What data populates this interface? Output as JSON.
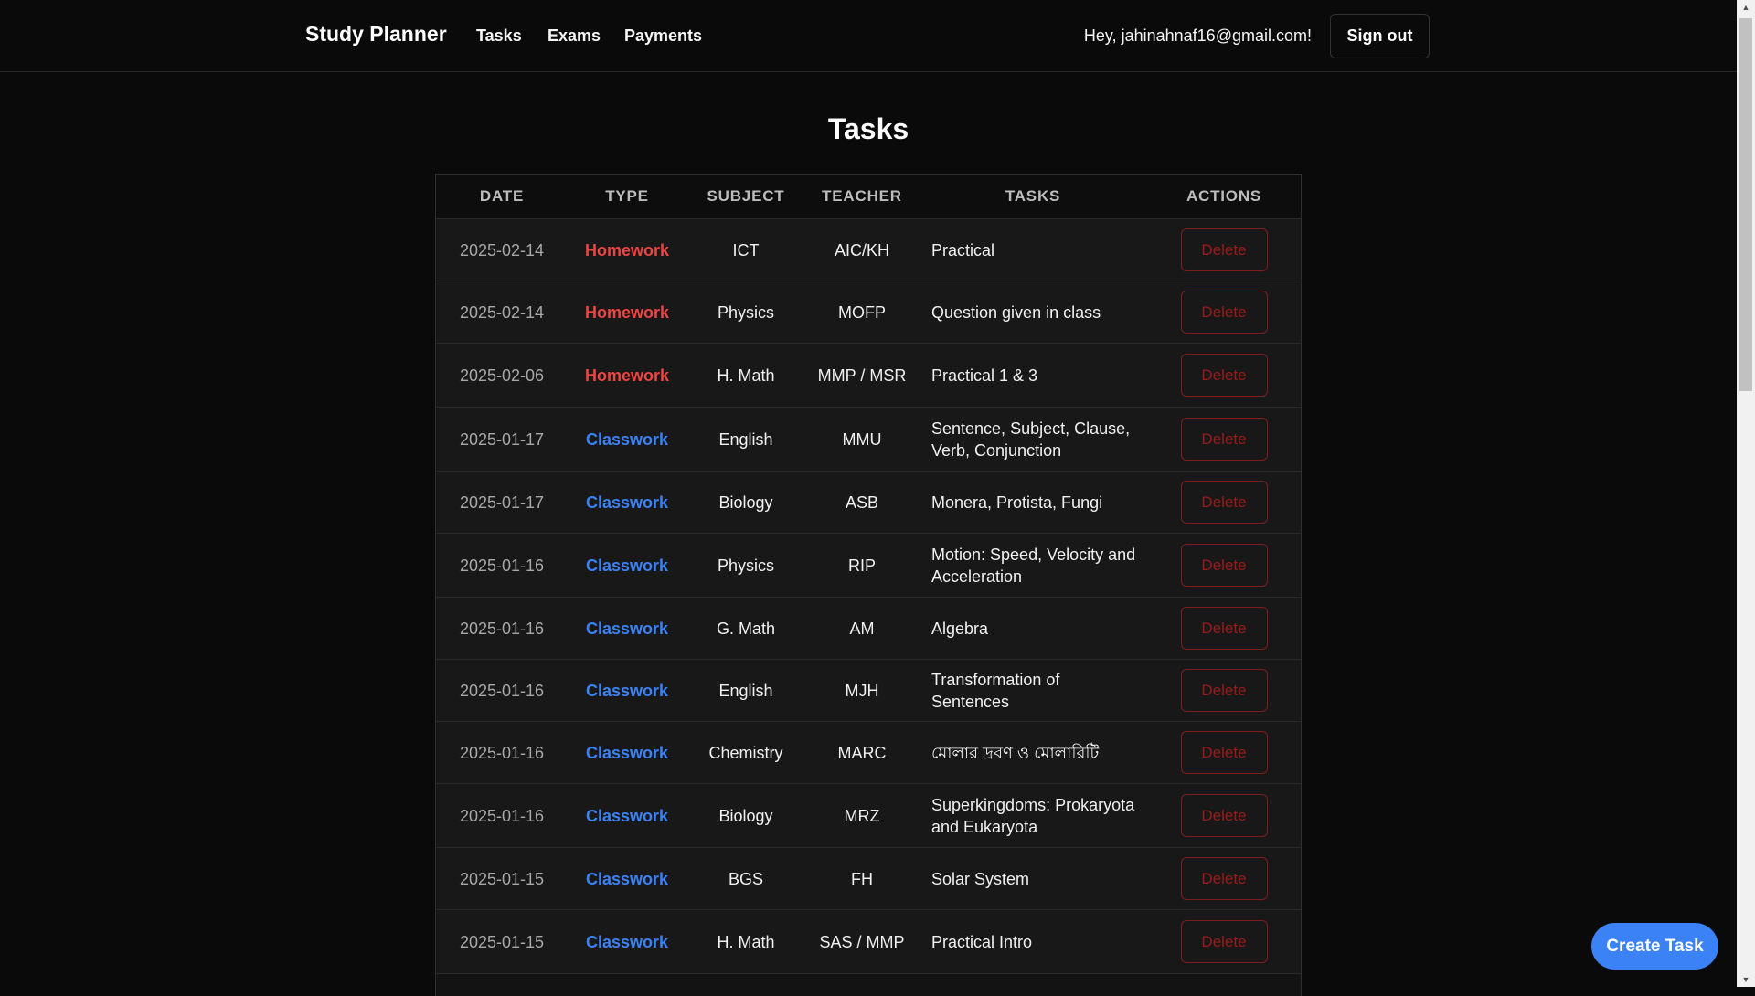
{
  "navbar": {
    "brand": "Study Planner",
    "links": [
      "Tasks",
      "Exams",
      "Payments"
    ],
    "greeting": "Hey, jahinahnaf16@gmail.com!",
    "signout_label": "Sign out"
  },
  "page": {
    "title": "Tasks"
  },
  "table": {
    "headers": [
      "DATE",
      "TYPE",
      "SUBJECT",
      "TEACHER",
      "TASKS",
      "ACTIONS"
    ],
    "delete_label": "Delete",
    "rows": [
      {
        "date": "2025-02-14",
        "type": "Homework",
        "subject": "ICT",
        "teacher": "AIC/KH",
        "task": "Practical"
      },
      {
        "date": "2025-02-14",
        "type": "Homework",
        "subject": "Physics",
        "teacher": "MOFP",
        "task": "Question given in class"
      },
      {
        "date": "2025-02-06",
        "type": "Homework",
        "subject": "H. Math",
        "teacher": "MMP / MSR",
        "task": "Practical 1 & 3"
      },
      {
        "date": "2025-01-17",
        "type": "Classwork",
        "subject": "English",
        "teacher": "MMU",
        "task": "Sentence, Subject, Clause, Verb, Conjunction"
      },
      {
        "date": "2025-01-17",
        "type": "Classwork",
        "subject": "Biology",
        "teacher": "ASB",
        "task": "Monera, Protista, Fungi"
      },
      {
        "date": "2025-01-16",
        "type": "Classwork",
        "subject": "Physics",
        "teacher": "RIP",
        "task": "Motion: Speed, Velocity and Acceleration"
      },
      {
        "date": "2025-01-16",
        "type": "Classwork",
        "subject": "G. Math",
        "teacher": "AM",
        "task": "Algebra"
      },
      {
        "date": "2025-01-16",
        "type": "Classwork",
        "subject": "English",
        "teacher": "MJH",
        "task": "Transformation of Sentences"
      },
      {
        "date": "2025-01-16",
        "type": "Classwork",
        "subject": "Chemistry",
        "teacher": "MARC",
        "task": "মোলার দ্রবণ ও মোলারিটি"
      },
      {
        "date": "2025-01-16",
        "type": "Classwork",
        "subject": "Biology",
        "teacher": "MRZ",
        "task": "Superkingdoms: Prokaryota and Eukaryota"
      },
      {
        "date": "2025-01-15",
        "type": "Classwork",
        "subject": "BGS",
        "teacher": "FH",
        "task": "Solar System"
      },
      {
        "date": "2025-01-15",
        "type": "Classwork",
        "subject": "H. Math",
        "teacher": "SAS / MMP",
        "task": "Practical Intro"
      }
    ]
  },
  "fab": {
    "label": "Create Task"
  },
  "colors": {
    "background": "#0a0a0a",
    "homework": "#ef4444",
    "classwork": "#3b82f6",
    "delete": "#991b1b",
    "primary": "#3b82f6"
  }
}
